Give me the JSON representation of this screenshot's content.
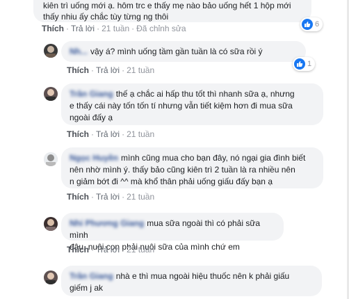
{
  "top": {
    "line1": "kiên trì uống mới ạ. hôm trc e thấy mẹ nào bảo uống hết 1 hộp mới",
    "line2": "thấy nhiu ấy chắc tùy từng ng thôi",
    "actions": {
      "like": "Thích",
      "reply": "Trả lời",
      "time": "21 tuần",
      "edited": "Đã chỉnh sửa"
    },
    "reaction_count": "6"
  },
  "replies": [
    {
      "author": "Nh...",
      "lines": [
        "vậy á? mình uống tầm gần tuần là có sữa rồi ý"
      ],
      "actions": {
        "like": "Thích",
        "reply": "Trả lời",
        "time": "21 tuần"
      },
      "reaction_count": "1"
    },
    {
      "author": "Trần Giang",
      "lines": [
        "thế ạ chắc ai hấp thu tốt thì nhanh sữa ạ, nhưng",
        "e thấy cái này tốn tốn tí nhưng vẫn tiết kiệm hơn đi mua sữa",
        "ngoài đấy ạ"
      ],
      "actions": {
        "like": "Thích",
        "reply": "Trả lời",
        "time": "21 tuần"
      }
    },
    {
      "author": "Ngọc Huyền",
      "lines": [
        "mình cũng mua cho bạn đây, nó ngại gia đình biết",
        "nên nhờ mình ý. thấy bảo cũng kiên trì 2 tuần là ra nhiều nên",
        "n giảm bớt đi ^^ mà khổ thân phải uống giấu đấy bạn ạ"
      ],
      "actions": {
        "like": "Thích",
        "reply": "Trả lời",
        "time": "21 tuần"
      }
    },
    {
      "author": "Nhi Phương Giang",
      "lines": [
        "mua sữa ngoài thì có phải sữa mình",
        "đâu, nuôi con phải nuôi sữa của mình chứ em"
      ],
      "actions": {
        "like": "Thích",
        "reply": "Trả lời",
        "time": "21 tuần"
      }
    },
    {
      "author": "Trần Giang",
      "lines": [
        "nhà e thì mua ngoài hiệu thuốc nên k phải giấu",
        "giếm j ak"
      ],
      "actions": {}
    }
  ]
}
